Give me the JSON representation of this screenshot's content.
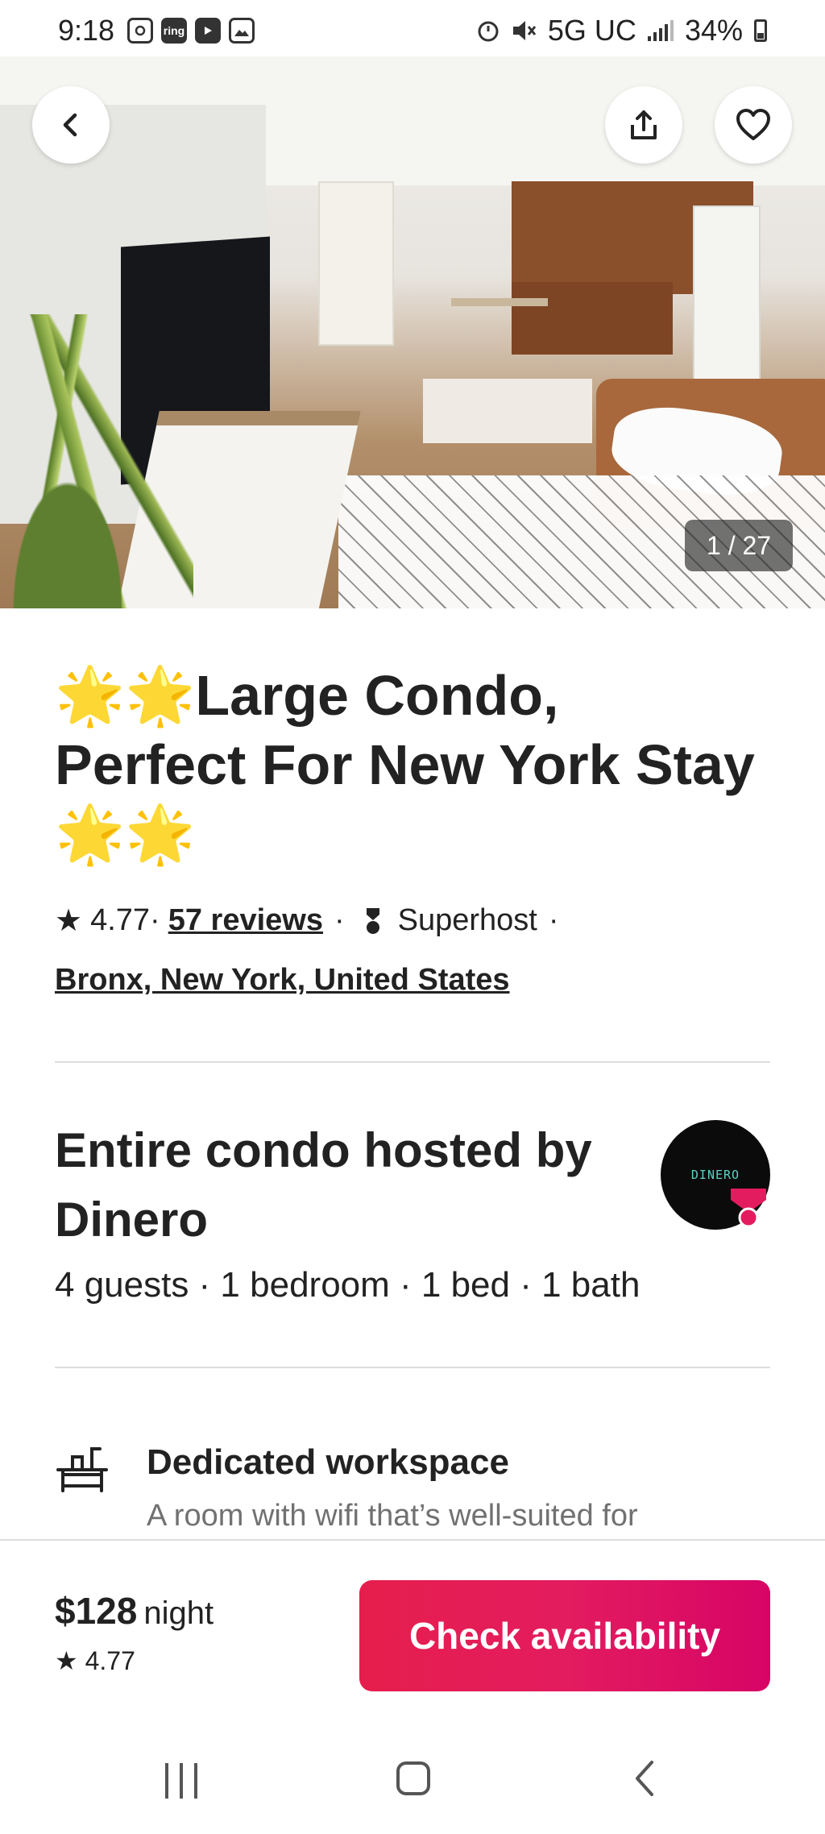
{
  "status_bar": {
    "time": "9:18",
    "network": "5G UC",
    "battery": "34%",
    "app_icons": [
      "instagram-icon",
      "ring-icon",
      "youtube-icon",
      "gallery-icon"
    ],
    "ring_label": "ring"
  },
  "gallery": {
    "counter": "1 / 27"
  },
  "listing": {
    "title": "🌟🌟Large Condo, Perfect For New York Stay🌟🌟",
    "rating": "4.77",
    "separator": "·",
    "reviews": "57 reviews",
    "superhost": "Superhost",
    "location": "Bronx, New York, United States"
  },
  "host": {
    "title": "Entire condo hosted by Dinero",
    "details": "4 guests · 1 bedroom · 1 bed · 1 bath",
    "avatar_text": "DINERO"
  },
  "feature": {
    "title": "Dedicated workspace",
    "description": "A room with wifi that’s well-suited for"
  },
  "booking": {
    "price": "$128",
    "unit": "night",
    "rating": "4.77",
    "button": "Check availability"
  },
  "colors": {
    "accent": "#E31C5F",
    "text": "#222222",
    "muted": "#717171",
    "divider": "#DDDDDD"
  }
}
